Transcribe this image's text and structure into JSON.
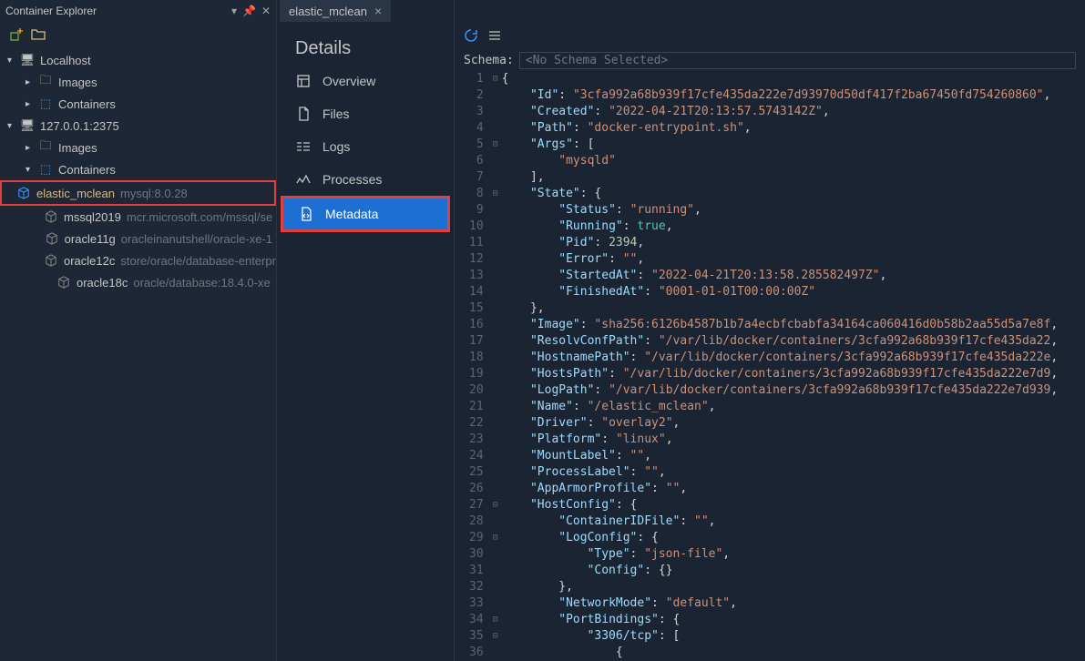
{
  "sidebar": {
    "title": "Container Explorer",
    "hosts": [
      {
        "label": "Localhost"
      },
      {
        "label": "127.0.0.1:2375"
      }
    ],
    "nodes": {
      "images": "Images",
      "containers": "Containers"
    },
    "containers": [
      {
        "name": "elastic_mclean",
        "sub": "mysql:8.0.28",
        "highlighted": true,
        "blue": true
      },
      {
        "name": "mssql2019",
        "sub": "mcr.microsoft.com/mssql/se",
        "blue": false
      },
      {
        "name": "oracle11g",
        "sub": "oracleinanutshell/oracle-xe-1",
        "blue": false
      },
      {
        "name": "oracle12c",
        "sub": "store/oracle/database-enterpr",
        "blue": false
      },
      {
        "name": "oracle18c",
        "sub": "oracle/database:18.4.0-xe",
        "blue": false
      }
    ]
  },
  "tab": {
    "label": "elastic_mclean"
  },
  "details": {
    "title": "Details",
    "items": [
      {
        "label": "Overview"
      },
      {
        "label": "Files"
      },
      {
        "label": "Logs"
      },
      {
        "label": "Processes"
      },
      {
        "label": "Metadata"
      }
    ]
  },
  "schema": {
    "label": "Schema:",
    "value": "<No Schema Selected>"
  },
  "code": {
    "lines": [
      {
        "n": 1,
        "fold": "-",
        "tokens": [
          [
            "punc",
            "{"
          ]
        ]
      },
      {
        "n": 2,
        "tokens": [
          [
            "ind",
            "    "
          ],
          [
            "key",
            "\"Id\""
          ],
          [
            "punc",
            ": "
          ],
          [
            "str",
            "\"3cfa992a68b939f17cfe435da222e7d93970d50df417f2ba67450fd754260860\""
          ],
          [
            "punc",
            ","
          ]
        ]
      },
      {
        "n": 3,
        "tokens": [
          [
            "ind",
            "    "
          ],
          [
            "key",
            "\"Created\""
          ],
          [
            "punc",
            ": "
          ],
          [
            "str",
            "\"2022-04-21T20:13:57.5743142Z\""
          ],
          [
            "punc",
            ","
          ]
        ]
      },
      {
        "n": 4,
        "tokens": [
          [
            "ind",
            "    "
          ],
          [
            "key",
            "\"Path\""
          ],
          [
            "punc",
            ": "
          ],
          [
            "str",
            "\"docker-entrypoint.sh\""
          ],
          [
            "punc",
            ","
          ]
        ]
      },
      {
        "n": 5,
        "fold": "-",
        "tokens": [
          [
            "ind",
            "    "
          ],
          [
            "key",
            "\"Args\""
          ],
          [
            "punc",
            ": ["
          ]
        ]
      },
      {
        "n": 6,
        "tokens": [
          [
            "ind",
            "        "
          ],
          [
            "str",
            "\"mysqld\""
          ]
        ]
      },
      {
        "n": 7,
        "tokens": [
          [
            "ind",
            "    "
          ],
          [
            "punc",
            "],"
          ]
        ]
      },
      {
        "n": 8,
        "fold": "-",
        "tokens": [
          [
            "ind",
            "    "
          ],
          [
            "key",
            "\"State\""
          ],
          [
            "punc",
            ": {"
          ]
        ]
      },
      {
        "n": 9,
        "tokens": [
          [
            "ind",
            "        "
          ],
          [
            "key",
            "\"Status\""
          ],
          [
            "punc",
            ": "
          ],
          [
            "str",
            "\"running\""
          ],
          [
            "punc",
            ","
          ]
        ]
      },
      {
        "n": 10,
        "tokens": [
          [
            "ind",
            "        "
          ],
          [
            "key",
            "\"Running\""
          ],
          [
            "punc",
            ": "
          ],
          [
            "bool",
            "true"
          ],
          [
            "punc",
            ","
          ]
        ]
      },
      {
        "n": 11,
        "tokens": [
          [
            "ind",
            "        "
          ],
          [
            "key",
            "\"Pid\""
          ],
          [
            "punc",
            ": "
          ],
          [
            "num",
            "2394"
          ],
          [
            "punc",
            ","
          ]
        ]
      },
      {
        "n": 12,
        "tokens": [
          [
            "ind",
            "        "
          ],
          [
            "key",
            "\"Error\""
          ],
          [
            "punc",
            ": "
          ],
          [
            "str",
            "\"\""
          ],
          [
            "punc",
            ","
          ]
        ]
      },
      {
        "n": 13,
        "tokens": [
          [
            "ind",
            "        "
          ],
          [
            "key",
            "\"StartedAt\""
          ],
          [
            "punc",
            ": "
          ],
          [
            "str",
            "\"2022-04-21T20:13:58.285582497Z\""
          ],
          [
            "punc",
            ","
          ]
        ]
      },
      {
        "n": 14,
        "tokens": [
          [
            "ind",
            "        "
          ],
          [
            "key",
            "\"FinishedAt\""
          ],
          [
            "punc",
            ": "
          ],
          [
            "str",
            "\"0001-01-01T00:00:00Z\""
          ]
        ]
      },
      {
        "n": 15,
        "tokens": [
          [
            "ind",
            "    "
          ],
          [
            "punc",
            "},"
          ]
        ]
      },
      {
        "n": 16,
        "tokens": [
          [
            "ind",
            "    "
          ],
          [
            "key",
            "\"Image\""
          ],
          [
            "punc",
            ": "
          ],
          [
            "str",
            "\"sha256:6126b4587b1b7a4ecbfcbabfa34164ca060416d0b58b2aa55d5a7e8f"
          ],
          [
            "punc",
            ","
          ]
        ]
      },
      {
        "n": 17,
        "tokens": [
          [
            "ind",
            "    "
          ],
          [
            "key",
            "\"ResolvConfPath\""
          ],
          [
            "punc",
            ": "
          ],
          [
            "str",
            "\"/var/lib/docker/containers/3cfa992a68b939f17cfe435da22"
          ],
          [
            "punc",
            ","
          ]
        ]
      },
      {
        "n": 18,
        "tokens": [
          [
            "ind",
            "    "
          ],
          [
            "key",
            "\"HostnamePath\""
          ],
          [
            "punc",
            ": "
          ],
          [
            "str",
            "\"/var/lib/docker/containers/3cfa992a68b939f17cfe435da222e"
          ],
          [
            "punc",
            ","
          ]
        ]
      },
      {
        "n": 19,
        "tokens": [
          [
            "ind",
            "    "
          ],
          [
            "key",
            "\"HostsPath\""
          ],
          [
            "punc",
            ": "
          ],
          [
            "str",
            "\"/var/lib/docker/containers/3cfa992a68b939f17cfe435da222e7d9"
          ],
          [
            "punc",
            ","
          ]
        ]
      },
      {
        "n": 20,
        "tokens": [
          [
            "ind",
            "    "
          ],
          [
            "key",
            "\"LogPath\""
          ],
          [
            "punc",
            ": "
          ],
          [
            "str",
            "\"/var/lib/docker/containers/3cfa992a68b939f17cfe435da222e7d939"
          ],
          [
            "punc",
            ","
          ]
        ]
      },
      {
        "n": 21,
        "tokens": [
          [
            "ind",
            "    "
          ],
          [
            "key",
            "\"Name\""
          ],
          [
            "punc",
            ": "
          ],
          [
            "str",
            "\"/elastic_mclean\""
          ],
          [
            "punc",
            ","
          ]
        ]
      },
      {
        "n": 22,
        "tokens": [
          [
            "ind",
            "    "
          ],
          [
            "key",
            "\"Driver\""
          ],
          [
            "punc",
            ": "
          ],
          [
            "str",
            "\"overlay2\""
          ],
          [
            "punc",
            ","
          ]
        ]
      },
      {
        "n": 23,
        "tokens": [
          [
            "ind",
            "    "
          ],
          [
            "key",
            "\"Platform\""
          ],
          [
            "punc",
            ": "
          ],
          [
            "str",
            "\"linux\""
          ],
          [
            "punc",
            ","
          ]
        ]
      },
      {
        "n": 24,
        "tokens": [
          [
            "ind",
            "    "
          ],
          [
            "key",
            "\"MountLabel\""
          ],
          [
            "punc",
            ": "
          ],
          [
            "str",
            "\"\""
          ],
          [
            "punc",
            ","
          ]
        ]
      },
      {
        "n": 25,
        "tokens": [
          [
            "ind",
            "    "
          ],
          [
            "key",
            "\"ProcessLabel\""
          ],
          [
            "punc",
            ": "
          ],
          [
            "str",
            "\"\""
          ],
          [
            "punc",
            ","
          ]
        ]
      },
      {
        "n": 26,
        "tokens": [
          [
            "ind",
            "    "
          ],
          [
            "key",
            "\"AppArmorProfile\""
          ],
          [
            "punc",
            ": "
          ],
          [
            "str",
            "\"\""
          ],
          [
            "punc",
            ","
          ]
        ]
      },
      {
        "n": 27,
        "fold": "-",
        "tokens": [
          [
            "ind",
            "    "
          ],
          [
            "key",
            "\"HostConfig\""
          ],
          [
            "punc",
            ": {"
          ]
        ]
      },
      {
        "n": 28,
        "tokens": [
          [
            "ind",
            "        "
          ],
          [
            "key",
            "\"ContainerIDFile\""
          ],
          [
            "punc",
            ": "
          ],
          [
            "str",
            "\"\""
          ],
          [
            "punc",
            ","
          ]
        ]
      },
      {
        "n": 29,
        "fold": "-",
        "tokens": [
          [
            "ind",
            "        "
          ],
          [
            "key",
            "\"LogConfig\""
          ],
          [
            "punc",
            ": {"
          ]
        ]
      },
      {
        "n": 30,
        "tokens": [
          [
            "ind",
            "            "
          ],
          [
            "key",
            "\"Type\""
          ],
          [
            "punc",
            ": "
          ],
          [
            "str",
            "\"json-file\""
          ],
          [
            "punc",
            ","
          ]
        ]
      },
      {
        "n": 31,
        "tokens": [
          [
            "ind",
            "            "
          ],
          [
            "key",
            "\"Config\""
          ],
          [
            "punc",
            ": {}"
          ]
        ]
      },
      {
        "n": 32,
        "tokens": [
          [
            "ind",
            "        "
          ],
          [
            "punc",
            "},"
          ]
        ]
      },
      {
        "n": 33,
        "tokens": [
          [
            "ind",
            "        "
          ],
          [
            "key",
            "\"NetworkMode\""
          ],
          [
            "punc",
            ": "
          ],
          [
            "str",
            "\"default\""
          ],
          [
            "punc",
            ","
          ]
        ]
      },
      {
        "n": 34,
        "fold": "-",
        "tokens": [
          [
            "ind",
            "        "
          ],
          [
            "key",
            "\"PortBindings\""
          ],
          [
            "punc",
            ": {"
          ]
        ]
      },
      {
        "n": 35,
        "fold": "-",
        "tokens": [
          [
            "ind",
            "            "
          ],
          [
            "key",
            "\"3306/tcp\""
          ],
          [
            "punc",
            ": ["
          ]
        ]
      },
      {
        "n": 36,
        "tokens": [
          [
            "ind",
            "                "
          ],
          [
            "punc",
            "{"
          ]
        ]
      }
    ]
  }
}
